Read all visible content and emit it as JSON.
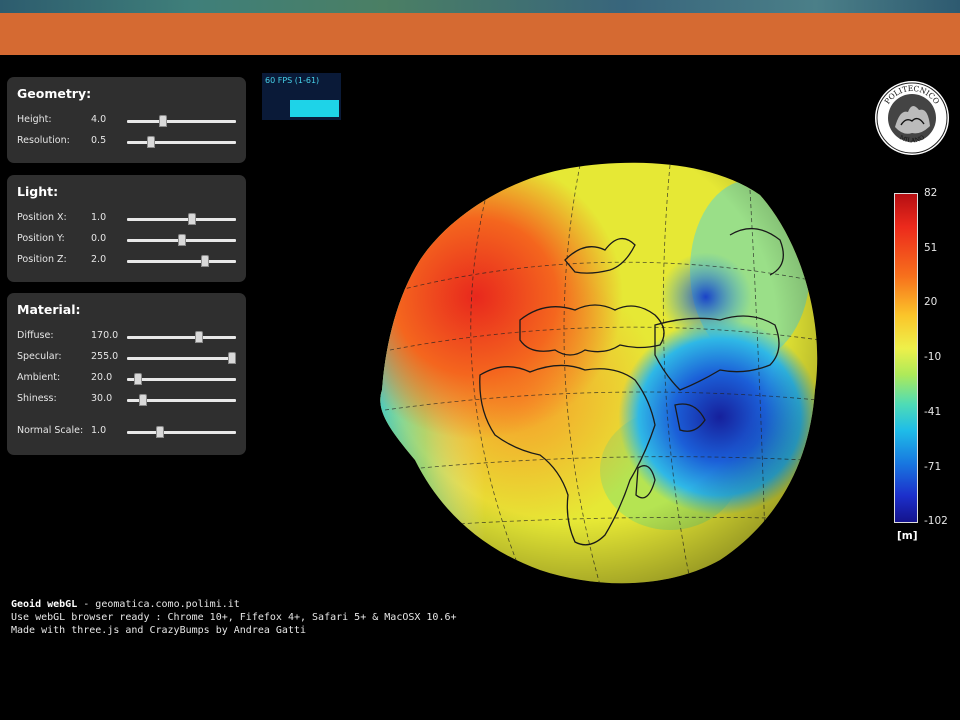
{
  "panels": [
    {
      "title": "Geometry:",
      "rows": [
        {
          "label": "Height:",
          "value": "4.0",
          "level": 0.33
        },
        {
          "label": "Resolution:",
          "value": "0.5",
          "level": 0.22
        }
      ]
    },
    {
      "title": "Light:",
      "rows": [
        {
          "label": "Position X:",
          "value": "1.0",
          "level": 0.6
        },
        {
          "label": "Position Y:",
          "value": "0.0",
          "level": 0.5
        },
        {
          "label": "Position Z:",
          "value": "2.0",
          "level": 0.72
        }
      ]
    },
    {
      "title": "Material:",
      "rows": [
        {
          "label": "Diffuse:",
          "value": "170.0",
          "level": 0.66
        },
        {
          "label": "Specular:",
          "value": "255.0",
          "level": 0.96
        },
        {
          "label": "Ambient:",
          "value": "20.0",
          "level": 0.1
        },
        {
          "label": "Shiness:",
          "value": "30.0",
          "level": 0.15
        },
        {
          "label": "Normal Scale:",
          "value": "1.0",
          "level": 0.3
        }
      ]
    }
  ],
  "fps": {
    "text": "60 FPS (1-61)"
  },
  "logo": {
    "text_top": "POLITECNICO",
    "text_bottom": "MILANO"
  },
  "colorbar": {
    "ticks": [
      "82",
      "51",
      "20",
      "-10",
      "-41",
      "-71",
      "-102"
    ],
    "unit": "[m]"
  },
  "footer": {
    "app_name": "Geoid webGL",
    "site": " - geomatica.como.polimi.it",
    "line2": "Use webGL browser ready : Chrome 10+, Fifefox 4+, Safari 5+ & MacOSX 10.6+",
    "line3": "Made with three.js and CrazyBumps by Andrea Gatti"
  },
  "colors": {
    "orange_band": "#d56a32",
    "panel_bg": "#2f2f2f",
    "fps_cyan": "#1ed3e8"
  }
}
